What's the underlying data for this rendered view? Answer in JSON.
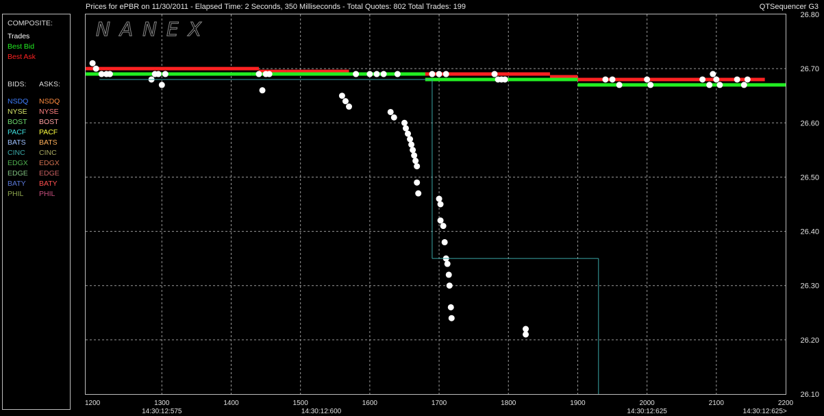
{
  "header": {
    "title": "Prices for  ePBR  on  11/30/2011  -  Elapsed Time: 2 Seconds, 350 Milliseconds  -  Total Quotes: 802  Total Trades: 199",
    "app_name": "QTSequencer G3"
  },
  "watermark": "NANEX",
  "legend": {
    "composite_header": "COMPOSITE:",
    "composite": [
      {
        "label": "Trades",
        "color": "#ffffff"
      },
      {
        "label": "Best Bid",
        "color": "#22ee22"
      },
      {
        "label": "Best Ask",
        "color": "#ff2222"
      }
    ],
    "bids_header": "BIDS:",
    "asks_header": "ASKS:",
    "bids": [
      {
        "label": "NSDQ",
        "color": "#3f7fff"
      },
      {
        "label": "NYSE",
        "color": "#d8e86a"
      },
      {
        "label": "BOST",
        "color": "#6fdc6f"
      },
      {
        "label": "PACF",
        "color": "#3fe0e0"
      },
      {
        "label": "BATS",
        "color": "#9ec0ff"
      },
      {
        "label": "CINC",
        "color": "#3aa7a7"
      },
      {
        "label": "EDGX",
        "color": "#4fb04f"
      },
      {
        "label": "EDGE",
        "color": "#7fc07f"
      },
      {
        "label": "BATY",
        "color": "#5a78d8"
      },
      {
        "label": "PHIL",
        "color": "#8fa84f"
      }
    ],
    "asks": [
      {
        "label": "NSDQ",
        "color": "#ff8c3f"
      },
      {
        "label": "NYSE",
        "color": "#ff7f7f"
      },
      {
        "label": "BOST",
        "color": "#ff9f9f"
      },
      {
        "label": "PACF",
        "color": "#ffff3f"
      },
      {
        "label": "BATS",
        "color": "#ffb05a"
      },
      {
        "label": "CINC",
        "color": "#a8a860"
      },
      {
        "label": "EDGX",
        "color": "#d07050"
      },
      {
        "label": "EDGE",
        "color": "#c86060"
      },
      {
        "label": "BATY",
        "color": "#ff4f4f"
      },
      {
        "label": "PHIL",
        "color": "#c84f7f"
      }
    ]
  },
  "chart_data": {
    "type": "scatter",
    "xlim": [
      1190,
      2200
    ],
    "ylim": [
      26.1,
      26.8
    ],
    "x_ticks": [
      1200,
      1300,
      1400,
      1500,
      1600,
      1700,
      1800,
      1900,
      2000,
      2100,
      2200
    ],
    "x_tick_labels": [
      "1200",
      "1300",
      "1400",
      "1500",
      "1600",
      "1700",
      "1800",
      "1900",
      "2000",
      "2100",
      "2200"
    ],
    "y_ticks": [
      26.1,
      26.2,
      26.3,
      26.4,
      26.5,
      26.6,
      26.7,
      26.8
    ],
    "y_tick_labels": [
      "26.10",
      "26.20",
      "26.30",
      "26.40",
      "26.50",
      "26.60",
      "26.70",
      "26.80"
    ],
    "time_labels": [
      {
        "x": 1300,
        "label": "14:30:12:575"
      },
      {
        "x": 1530,
        "label": "14:30:12:600"
      },
      {
        "x": 2000,
        "label": "14:30:12:625"
      },
      {
        "x": 2170,
        "label": "14:30:12:625>"
      }
    ],
    "grid": true,
    "series": [
      {
        "name": "Best Ask",
        "color": "#ff2222",
        "segments": [
          [
            1190,
            1440,
            26.7
          ],
          [
            1440,
            1480,
            26.695
          ],
          [
            1480,
            1570,
            26.695
          ],
          [
            1570,
            1690,
            26.69
          ],
          [
            1690,
            1860,
            26.69
          ],
          [
            1860,
            1900,
            26.685
          ],
          [
            1900,
            2170,
            26.68
          ]
        ]
      },
      {
        "name": "Best Bid",
        "color": "#22ee22",
        "segments": [
          [
            1190,
            1430,
            26.69
          ],
          [
            1430,
            1680,
            26.69
          ],
          [
            1680,
            1700,
            26.68
          ],
          [
            1700,
            1900,
            26.68
          ],
          [
            1900,
            2200,
            26.67
          ]
        ]
      },
      {
        "name": "Trades",
        "color": "#ffffff",
        "points": [
          [
            1200,
            26.71
          ],
          [
            1205,
            26.7
          ],
          [
            1213,
            26.69
          ],
          [
            1220,
            26.69
          ],
          [
            1225,
            26.69
          ],
          [
            1285,
            26.68
          ],
          [
            1290,
            26.69
          ],
          [
            1295,
            26.69
          ],
          [
            1300,
            26.67
          ],
          [
            1305,
            26.69
          ],
          [
            1440,
            26.69
          ],
          [
            1445,
            26.66
          ],
          [
            1450,
            26.69
          ],
          [
            1455,
            26.69
          ],
          [
            1560,
            26.65
          ],
          [
            1565,
            26.64
          ],
          [
            1570,
            26.63
          ],
          [
            1630,
            26.62
          ],
          [
            1635,
            26.61
          ],
          [
            1650,
            26.6
          ],
          [
            1652,
            26.59
          ],
          [
            1655,
            26.58
          ],
          [
            1658,
            26.57
          ],
          [
            1660,
            26.56
          ],
          [
            1662,
            26.55
          ],
          [
            1664,
            26.54
          ],
          [
            1666,
            26.53
          ],
          [
            1668,
            26.52
          ],
          [
            1668,
            26.49
          ],
          [
            1670,
            26.47
          ],
          [
            1700,
            26.46
          ],
          [
            1702,
            26.45
          ],
          [
            1702,
            26.42
          ],
          [
            1706,
            26.41
          ],
          [
            1708,
            26.38
          ],
          [
            1710,
            26.35
          ],
          [
            1712,
            26.34
          ],
          [
            1714,
            26.32
          ],
          [
            1715,
            26.3
          ],
          [
            1717,
            26.26
          ],
          [
            1718,
            26.24
          ],
          [
            1825,
            26.22
          ],
          [
            1825,
            26.21
          ],
          [
            1580,
            26.69
          ],
          [
            1600,
            26.69
          ],
          [
            1610,
            26.69
          ],
          [
            1620,
            26.69
          ],
          [
            1640,
            26.69
          ],
          [
            1690,
            26.69
          ],
          [
            1700,
            26.69
          ],
          [
            1710,
            26.69
          ],
          [
            1780,
            26.69
          ],
          [
            1785,
            26.68
          ],
          [
            1790,
            26.68
          ],
          [
            1795,
            26.68
          ],
          [
            1940,
            26.68
          ],
          [
            1950,
            26.68
          ],
          [
            1960,
            26.67
          ],
          [
            2000,
            26.68
          ],
          [
            2005,
            26.67
          ],
          [
            2080,
            26.68
          ],
          [
            2090,
            26.67
          ],
          [
            2095,
            26.69
          ],
          [
            2100,
            26.68
          ],
          [
            2105,
            26.67
          ],
          [
            2130,
            26.68
          ],
          [
            2140,
            26.67
          ],
          [
            2145,
            26.68
          ]
        ]
      },
      {
        "name": "PACF",
        "color": "#3aa7a7",
        "segments": [
          [
            1210,
            1690,
            26.68
          ],
          [
            1690,
            1690,
            26.35
          ],
          [
            1690,
            1930,
            26.35
          ],
          [
            1930,
            1930,
            26.1
          ]
        ]
      }
    ]
  }
}
